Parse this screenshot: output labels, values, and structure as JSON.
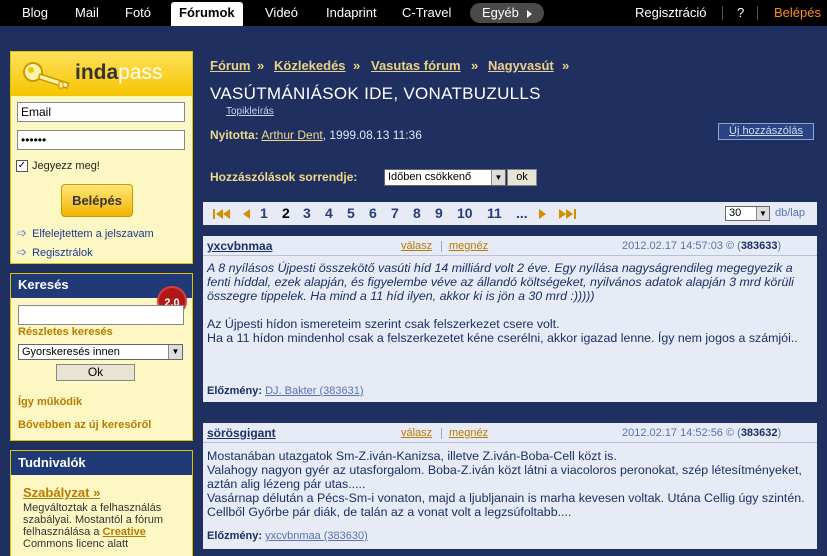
{
  "topnav": {
    "items": [
      "Blog",
      "Mail",
      "Fotó",
      "Fórumok",
      "Videó",
      "Indaprint",
      "C-Travel"
    ],
    "more": "Egyéb",
    "register": "Regisztráció",
    "help": "?",
    "login": "Belépés"
  },
  "login": {
    "logo_inda": "inda",
    "logo_pass": "pass",
    "email_value": "Email",
    "password_value": "••••••",
    "remember": "Jegyezz meg!",
    "submit": "Belépés",
    "forgot": "Elfelejtettem a jelszavam",
    "register": "Regisztrálok"
  },
  "search": {
    "title": "Keresés",
    "badge": "2.0",
    "advanced": "Részletes keresés",
    "scope": "Gyorskeresés innen",
    "ok": "Ok",
    "how": "Így működik",
    "more": "Bővebben az új keresőről"
  },
  "info": {
    "title": "Tudnivalók",
    "rules": "Szabályzat »",
    "text": "Megváltoztak a felhasználás szabályai. Mostantól a fórum felhasználása a ",
    "text_link": "Creative",
    "text_tail": " Commons licenc alatt"
  },
  "breadcrumb": [
    "Fórum",
    "Közlekedés",
    "Vasutas fórum",
    "Nagyvasút"
  ],
  "breadcrumb_sep": "»",
  "topic": {
    "title": "VASÚTMÁNIÁSOK IDE, VONATBUZULLS",
    "desc_link": "Topikleírás",
    "opener_label": "Nyitotta:",
    "opener_name": "Arthur Dent",
    "opener_date": ", 1999.08.13 11:36",
    "new_post": "Új hozzászólás"
  },
  "order": {
    "label": "Hozzászólások sorrendje:",
    "value": "Időben csökkenő",
    "ok": "ok"
  },
  "pager": {
    "pages": [
      "1",
      "2",
      "3",
      "4",
      "5",
      "6",
      "7",
      "8",
      "9",
      "10",
      "11",
      "..."
    ],
    "current": "2",
    "per_page": "30",
    "per_label": "db/lap"
  },
  "posts": [
    {
      "author": "yxcvbnmaa",
      "reply": "válasz",
      "view": "megnéz",
      "date": "2012.02.17 14:57:03 © (",
      "id": "383633",
      "id_close": ")",
      "quote": "A 8 nyílásos Újpesti összekötő vasúti híd 14 milliárd volt 2 éve. Egy nyílása nagyságrendileg megegyezik a fenti híddal, ezek alapján, és figyelembe véve az állandó költségeket, nyilvános adatok alapján 3 mrd körüli összegre tippelek. Ha mind a 11 híd ilyen, akkor ki is jön a 30 mrd :)))))",
      "text": "Az Újpesti hídon ismereteim szerint csak felszerkezet csere volt.\nHa a 11 hídon mindenhol csak a felszerkezetet kéne cserélni, akkor igazad lenne. Így nem jogos a számjói..",
      "ref_label": "Előzmény:",
      "ref": "DJ. Bakter (383631)"
    },
    {
      "author": "sörösgigant",
      "reply": "válasz",
      "view": "megnéz",
      "date": "2012.02.17 14:52:56 © (",
      "id": "383632",
      "id_close": ")",
      "text": "Mostanában utazgatok Sm-Z.iván-Kanizsa, illetve Z.iván-Boba-Cell közt is.\nValahogy nagyon gyér az utasforgalom. Boba-Z.iván közt látni a viacoloros peronokat, szép létesítményeket, aztán alig lézeng pár utas.....\nVasárnap délután a Pécs-Sm-i vonaton, majd a ljubljanain is marha kevesen voltak. Utána Cellig úgy szintén. Cellből Győrbe pár diák, de talán az a vonat volt a legzsúfoltabb....",
      "ref_label": "Előzmény:",
      "ref": "yxcvbnmaa (383630)"
    }
  ],
  "colors": {
    "page_bg": "#1f3060",
    "accent": "#f1d98a",
    "post_bg": "#e6ebf5",
    "login_orange": "#ff8c1a"
  }
}
